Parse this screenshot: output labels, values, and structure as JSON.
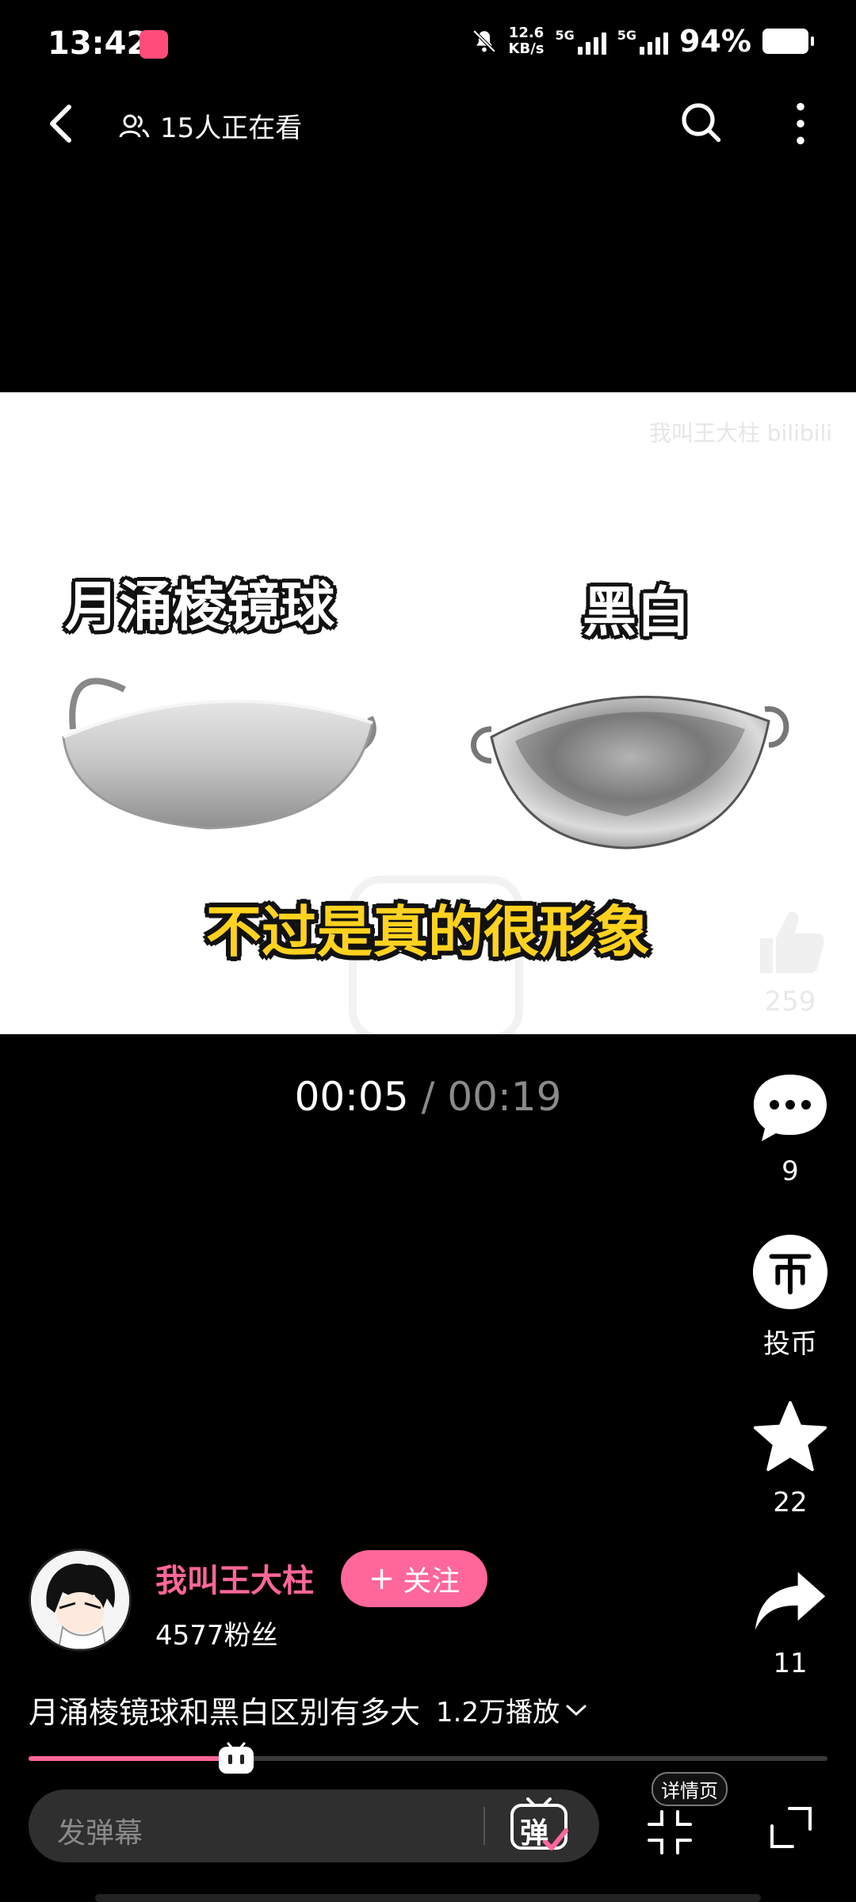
{
  "status": {
    "time": "13:42",
    "net_speed_value": "12.6",
    "net_speed_unit": "KB/s",
    "net1": "5G",
    "net2": "5G",
    "battery": "94%"
  },
  "header": {
    "watching": "15人正在看"
  },
  "video": {
    "watermark": "我叫王大柱 bilibili",
    "left_label": "月涌棱镜球",
    "right_label": "黑白",
    "subtitle": "不过是真的很形象",
    "current_time": "00:05",
    "separator": "/",
    "total_time": "00:19",
    "progress_fraction": 0.26
  },
  "rail": {
    "likes": "259",
    "comments": "9",
    "coin_label": "投币",
    "favorites": "22",
    "shares": "11"
  },
  "uploader": {
    "name": "我叫王大柱",
    "follow_label": "关注",
    "follow_plus": "+",
    "fans": "4577粉丝"
  },
  "info": {
    "title": "月涌棱镜球和黑白区别有多大",
    "plays": "1.2万播放"
  },
  "bottom": {
    "danmaku_placeholder": "发弹幕",
    "danmaku_btn": "弹",
    "detail_label": "详情页"
  },
  "colors": {
    "accent": "#ff6699",
    "subtitle": "#ffd21f"
  }
}
